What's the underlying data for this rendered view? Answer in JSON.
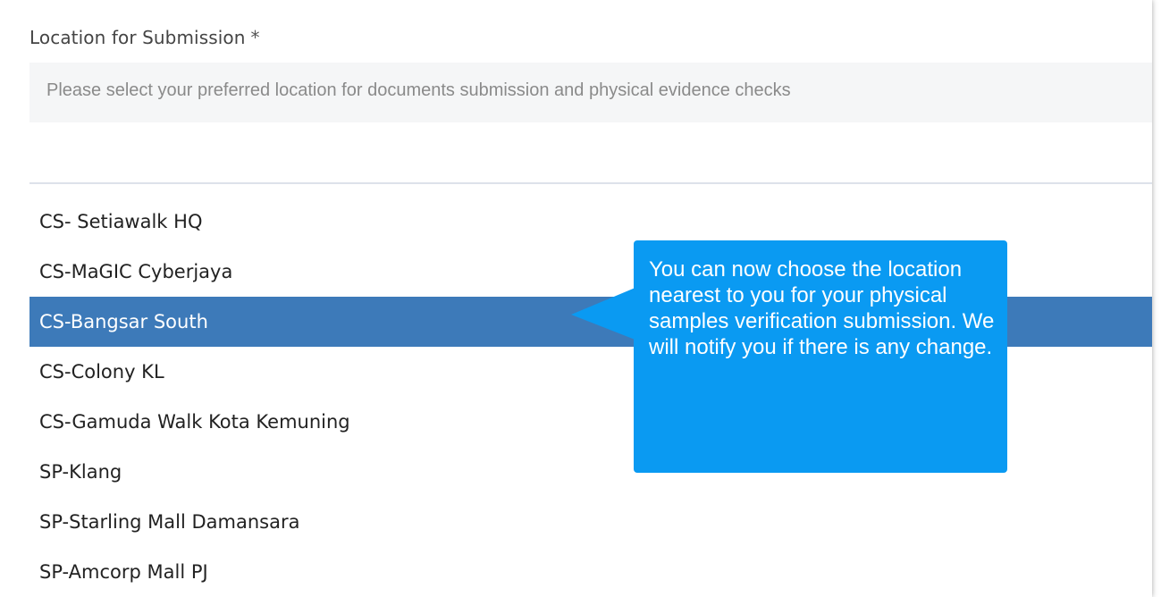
{
  "field": {
    "label": "Location for Submission",
    "required_marker": "*",
    "hint": "Please select your preferred location for documents submission and physical evidence checks"
  },
  "search": {
    "value": "",
    "placeholder": ""
  },
  "options": [
    {
      "label": "CS- Setiawalk HQ",
      "selected": false
    },
    {
      "label": "CS-MaGIC Cyberjaya",
      "selected": false
    },
    {
      "label": "CS-Bangsar South",
      "selected": true
    },
    {
      "label": "CS-Colony KL",
      "selected": false
    },
    {
      "label": "CS-Gamuda Walk Kota Kemuning",
      "selected": false
    },
    {
      "label": "SP-Klang",
      "selected": false
    },
    {
      "label": "SP-Starling Mall Damansara",
      "selected": false
    },
    {
      "label": "SP-Amcorp Mall PJ",
      "selected": false
    }
  ],
  "tooltip": {
    "text": "You can now choose the location nearest to you for your physical samples verification submission. We will notify you if there is any change."
  },
  "colors": {
    "selected_bg": "#3d7ab9",
    "tooltip_bg": "#0a9af2",
    "hint_bg": "#f5f6f7"
  }
}
